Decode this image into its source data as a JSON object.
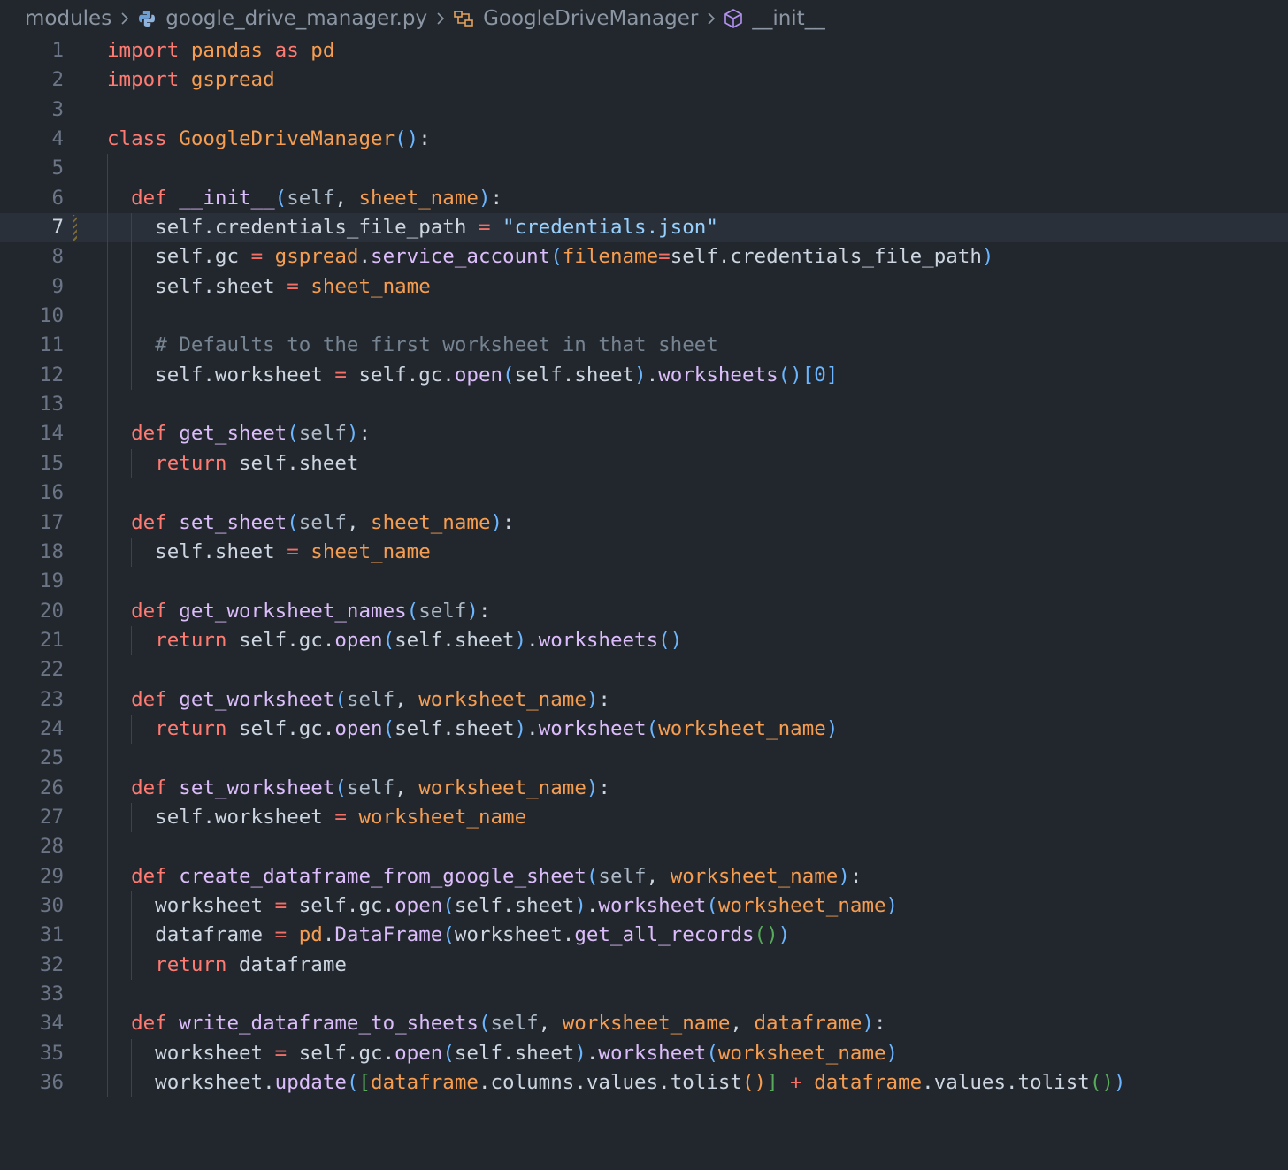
{
  "breadcrumb": {
    "items": [
      {
        "label": "modules",
        "icon": null
      },
      {
        "label": "google_drive_manager.py",
        "icon": "python-file-icon"
      },
      {
        "label": "GoogleDriveManager",
        "icon": "class-symbol-icon"
      },
      {
        "label": "__init__",
        "icon": "method-symbol-icon"
      }
    ],
    "separator_icon": "chevron-right-icon"
  },
  "editor": {
    "language": "python",
    "current_line": 7,
    "lines": [
      {
        "n": "1",
        "tokens": [
          [
            "kw",
            "import"
          ],
          [
            "t",
            " "
          ],
          [
            "mod",
            "pandas"
          ],
          [
            "t",
            " "
          ],
          [
            "kw",
            "as"
          ],
          [
            "t",
            " "
          ],
          [
            "mod",
            "pd"
          ]
        ]
      },
      {
        "n": "2",
        "tokens": [
          [
            "kw",
            "import"
          ],
          [
            "t",
            " "
          ],
          [
            "mod",
            "gspread"
          ]
        ]
      },
      {
        "n": "3",
        "tokens": []
      },
      {
        "n": "4",
        "tokens": [
          [
            "kw",
            "class"
          ],
          [
            "t",
            " "
          ],
          [
            "cls",
            "GoogleDriveManager"
          ],
          [
            "p1",
            "()"
          ],
          [
            "t",
            ":"
          ]
        ]
      },
      {
        "n": "5",
        "tokens": []
      },
      {
        "n": "6",
        "tokens": [
          [
            "t",
            "  "
          ],
          [
            "kw",
            "def"
          ],
          [
            "t",
            " "
          ],
          [
            "fn",
            "__init__"
          ],
          [
            "p1",
            "("
          ],
          [
            "slf",
            "self"
          ],
          [
            "t",
            ", "
          ],
          [
            "prm",
            "sheet_name"
          ],
          [
            "p1",
            ")"
          ],
          [
            "t",
            ":"
          ]
        ]
      },
      {
        "n": "7",
        "tokens": [
          [
            "t",
            "    self.credentials_file_path "
          ],
          [
            "op",
            "="
          ],
          [
            "t",
            " "
          ],
          [
            "str",
            "\"credentials.json\""
          ]
        ]
      },
      {
        "n": "8",
        "tokens": [
          [
            "t",
            "    self.gc "
          ],
          [
            "op",
            "="
          ],
          [
            "t",
            " "
          ],
          [
            "mod",
            "gspread"
          ],
          [
            "t",
            "."
          ],
          [
            "fn",
            "service_account"
          ],
          [
            "p1",
            "("
          ],
          [
            "prm",
            "filename"
          ],
          [
            "op",
            "="
          ],
          [
            "t",
            "self.credentials_file_path"
          ],
          [
            "p1",
            ")"
          ]
        ]
      },
      {
        "n": "9",
        "tokens": [
          [
            "t",
            "    self.sheet "
          ],
          [
            "op",
            "="
          ],
          [
            "t",
            " "
          ],
          [
            "prm",
            "sheet_name"
          ]
        ]
      },
      {
        "n": "10",
        "tokens": []
      },
      {
        "n": "11",
        "tokens": [
          [
            "t",
            "    "
          ],
          [
            "cm",
            "# Defaults to the first worksheet in that sheet"
          ]
        ]
      },
      {
        "n": "12",
        "tokens": [
          [
            "t",
            "    self.worksheet "
          ],
          [
            "op",
            "="
          ],
          [
            "t",
            " self.gc."
          ],
          [
            "fn",
            "open"
          ],
          [
            "p1",
            "("
          ],
          [
            "t",
            "self.sheet"
          ],
          [
            "p1",
            ")"
          ],
          [
            "t",
            "."
          ],
          [
            "fn",
            "worksheets"
          ],
          [
            "p1",
            "()"
          ],
          [
            "num",
            "[0]"
          ]
        ]
      },
      {
        "n": "13",
        "tokens": []
      },
      {
        "n": "14",
        "tokens": [
          [
            "t",
            "  "
          ],
          [
            "kw",
            "def"
          ],
          [
            "t",
            " "
          ],
          [
            "fn",
            "get_sheet"
          ],
          [
            "p1",
            "("
          ],
          [
            "slf",
            "self"
          ],
          [
            "p1",
            ")"
          ],
          [
            "t",
            ":"
          ]
        ]
      },
      {
        "n": "15",
        "tokens": [
          [
            "t",
            "    "
          ],
          [
            "kw",
            "return"
          ],
          [
            "t",
            " self.sheet"
          ]
        ]
      },
      {
        "n": "16",
        "tokens": []
      },
      {
        "n": "17",
        "tokens": [
          [
            "t",
            "  "
          ],
          [
            "kw",
            "def"
          ],
          [
            "t",
            " "
          ],
          [
            "fn",
            "set_sheet"
          ],
          [
            "p1",
            "("
          ],
          [
            "slf",
            "self"
          ],
          [
            "t",
            ", "
          ],
          [
            "prm",
            "sheet_name"
          ],
          [
            "p1",
            ")"
          ],
          [
            "t",
            ":"
          ]
        ]
      },
      {
        "n": "18",
        "tokens": [
          [
            "t",
            "    self.sheet "
          ],
          [
            "op",
            "="
          ],
          [
            "t",
            " "
          ],
          [
            "prm",
            "sheet_name"
          ]
        ]
      },
      {
        "n": "19",
        "tokens": []
      },
      {
        "n": "20",
        "tokens": [
          [
            "t",
            "  "
          ],
          [
            "kw",
            "def"
          ],
          [
            "t",
            " "
          ],
          [
            "fn",
            "get_worksheet_names"
          ],
          [
            "p1",
            "("
          ],
          [
            "slf",
            "self"
          ],
          [
            "p1",
            ")"
          ],
          [
            "t",
            ":"
          ]
        ]
      },
      {
        "n": "21",
        "tokens": [
          [
            "t",
            "    "
          ],
          [
            "kw",
            "return"
          ],
          [
            "t",
            " self.gc."
          ],
          [
            "fn",
            "open"
          ],
          [
            "p1",
            "("
          ],
          [
            "t",
            "self.sheet"
          ],
          [
            "p1",
            ")"
          ],
          [
            "t",
            "."
          ],
          [
            "fn",
            "worksheets"
          ],
          [
            "p1",
            "()"
          ]
        ]
      },
      {
        "n": "22",
        "tokens": []
      },
      {
        "n": "23",
        "tokens": [
          [
            "t",
            "  "
          ],
          [
            "kw",
            "def"
          ],
          [
            "t",
            " "
          ],
          [
            "fn",
            "get_worksheet"
          ],
          [
            "p1",
            "("
          ],
          [
            "slf",
            "self"
          ],
          [
            "t",
            ", "
          ],
          [
            "prm",
            "worksheet_name"
          ],
          [
            "p1",
            ")"
          ],
          [
            "t",
            ":"
          ]
        ]
      },
      {
        "n": "24",
        "tokens": [
          [
            "t",
            "    "
          ],
          [
            "kw",
            "return"
          ],
          [
            "t",
            " self.gc."
          ],
          [
            "fn",
            "open"
          ],
          [
            "p1",
            "("
          ],
          [
            "t",
            "self.sheet"
          ],
          [
            "p1",
            ")"
          ],
          [
            "t",
            "."
          ],
          [
            "fn",
            "worksheet"
          ],
          [
            "p1",
            "("
          ],
          [
            "prm",
            "worksheet_name"
          ],
          [
            "p1",
            ")"
          ]
        ]
      },
      {
        "n": "25",
        "tokens": []
      },
      {
        "n": "26",
        "tokens": [
          [
            "t",
            "  "
          ],
          [
            "kw",
            "def"
          ],
          [
            "t",
            " "
          ],
          [
            "fn",
            "set_worksheet"
          ],
          [
            "p1",
            "("
          ],
          [
            "slf",
            "self"
          ],
          [
            "t",
            ", "
          ],
          [
            "prm",
            "worksheet_name"
          ],
          [
            "p1",
            ")"
          ],
          [
            "t",
            ":"
          ]
        ]
      },
      {
        "n": "27",
        "tokens": [
          [
            "t",
            "    self.worksheet "
          ],
          [
            "op",
            "="
          ],
          [
            "t",
            " "
          ],
          [
            "prm",
            "worksheet_name"
          ]
        ]
      },
      {
        "n": "28",
        "tokens": []
      },
      {
        "n": "29",
        "tokens": [
          [
            "t",
            "  "
          ],
          [
            "kw",
            "def"
          ],
          [
            "t",
            " "
          ],
          [
            "fn",
            "create_dataframe_from_google_sheet"
          ],
          [
            "p1",
            "("
          ],
          [
            "slf",
            "self"
          ],
          [
            "t",
            ", "
          ],
          [
            "prm",
            "worksheet_name"
          ],
          [
            "p1",
            ")"
          ],
          [
            "t",
            ":"
          ]
        ]
      },
      {
        "n": "30",
        "tokens": [
          [
            "t",
            "    worksheet "
          ],
          [
            "op",
            "="
          ],
          [
            "t",
            " self.gc."
          ],
          [
            "fn",
            "open"
          ],
          [
            "p1",
            "("
          ],
          [
            "t",
            "self.sheet"
          ],
          [
            "p1",
            ")"
          ],
          [
            "t",
            "."
          ],
          [
            "fn",
            "worksheet"
          ],
          [
            "p1",
            "("
          ],
          [
            "prm",
            "worksheet_name"
          ],
          [
            "p1",
            ")"
          ]
        ]
      },
      {
        "n": "31",
        "tokens": [
          [
            "t",
            "    dataframe "
          ],
          [
            "op",
            "="
          ],
          [
            "t",
            " "
          ],
          [
            "mod",
            "pd"
          ],
          [
            "t",
            "."
          ],
          [
            "fn",
            "DataFrame"
          ],
          [
            "p1",
            "("
          ],
          [
            "t",
            "worksheet."
          ],
          [
            "fn",
            "get_all_records"
          ],
          [
            "p3",
            "()"
          ],
          [
            "p1",
            ")"
          ]
        ]
      },
      {
        "n": "32",
        "tokens": [
          [
            "t",
            "    "
          ],
          [
            "kw",
            "return"
          ],
          [
            "t",
            " dataframe"
          ]
        ]
      },
      {
        "n": "33",
        "tokens": []
      },
      {
        "n": "34",
        "tokens": [
          [
            "t",
            "  "
          ],
          [
            "kw",
            "def"
          ],
          [
            "t",
            " "
          ],
          [
            "fn",
            "write_dataframe_to_sheets"
          ],
          [
            "p1",
            "("
          ],
          [
            "slf",
            "self"
          ],
          [
            "t",
            ", "
          ],
          [
            "prm",
            "worksheet_name"
          ],
          [
            "t",
            ", "
          ],
          [
            "prm",
            "dataframe"
          ],
          [
            "p1",
            ")"
          ],
          [
            "t",
            ":"
          ]
        ]
      },
      {
        "n": "35",
        "tokens": [
          [
            "t",
            "    worksheet "
          ],
          [
            "op",
            "="
          ],
          [
            "t",
            " self.gc."
          ],
          [
            "fn",
            "open"
          ],
          [
            "p1",
            "("
          ],
          [
            "t",
            "self.sheet"
          ],
          [
            "p1",
            ")"
          ],
          [
            "t",
            "."
          ],
          [
            "fn",
            "worksheet"
          ],
          [
            "p1",
            "("
          ],
          [
            "prm",
            "worksheet_name"
          ],
          [
            "p1",
            ")"
          ]
        ]
      },
      {
        "n": "36",
        "tokens": [
          [
            "t",
            "    worksheet."
          ],
          [
            "fn",
            "update"
          ],
          [
            "p1",
            "("
          ],
          [
            "p3",
            "["
          ],
          [
            "prm",
            "dataframe"
          ],
          [
            "t",
            ".columns.values.tolist"
          ],
          [
            "p2",
            "()"
          ],
          [
            "p3",
            "]"
          ],
          [
            "t",
            " "
          ],
          [
            "op",
            "+"
          ],
          [
            "t",
            " "
          ],
          [
            "prm",
            "dataframe"
          ],
          [
            "t",
            ".values.tolist"
          ],
          [
            "p3",
            "()"
          ],
          [
            "p1",
            ")"
          ]
        ]
      }
    ]
  }
}
